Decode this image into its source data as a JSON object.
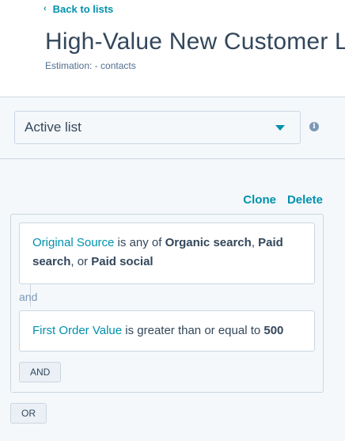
{
  "header": {
    "back_icon": "chevron-left-icon",
    "back_label": "Back to lists",
    "title": "High-Value New Customer L",
    "estimation": "Estimation: - contacts"
  },
  "list_type": {
    "selected": "Active list",
    "info_icon": "info-icon",
    "info_glyph": "i"
  },
  "actions": {
    "clone_label": "Clone",
    "delete_label": "Delete"
  },
  "filters": [
    {
      "property": "Original Source",
      "operator": " is any of ",
      "value_1": "Organic search",
      "sep_1": ", ",
      "value_2": "Paid search",
      "sep_2": ", or ",
      "value_3": "Paid social"
    },
    {
      "property": "First Order Value",
      "operator": " is greater than or equal to ",
      "value": "500"
    }
  ],
  "group": {
    "and_text": "and",
    "and_button": "AND",
    "or_button": "OR"
  },
  "colors": {
    "accent": "#0091ae",
    "text": "#33475b",
    "panel_bg": "#f5f8fa",
    "border": "#cbd6e2"
  }
}
